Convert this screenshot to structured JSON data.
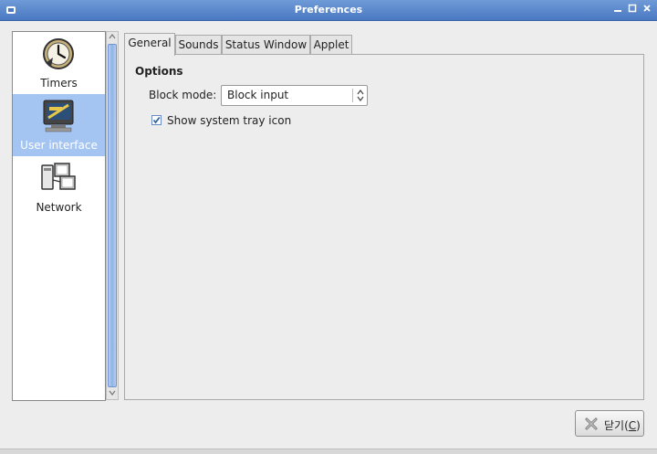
{
  "window": {
    "title": "Preferences"
  },
  "sidebar": {
    "items": [
      {
        "label": "Timers",
        "icon": "clock-icon",
        "selected": false
      },
      {
        "label": "User interface",
        "icon": "monitor-icon",
        "selected": true
      },
      {
        "label": "Network",
        "icon": "network-icon",
        "selected": false
      }
    ]
  },
  "tabs": [
    {
      "label": "General",
      "active": true
    },
    {
      "label": "Sounds",
      "active": false
    },
    {
      "label": "Status Window",
      "active": false
    },
    {
      "label": "Applet",
      "active": false
    }
  ],
  "general": {
    "section_title": "Options",
    "block_mode_label": "Block mode:",
    "block_mode_value": "Block input",
    "tray_checkbox_label": "Show system tray icon",
    "tray_checkbox_checked": true
  },
  "footer": {
    "close_label_prefix": "닫기(",
    "close_mnemonic": "C",
    "close_label_suffix": ")"
  },
  "colors": {
    "titlebar": "#4a78c2",
    "selection": "#a4c5f2"
  }
}
